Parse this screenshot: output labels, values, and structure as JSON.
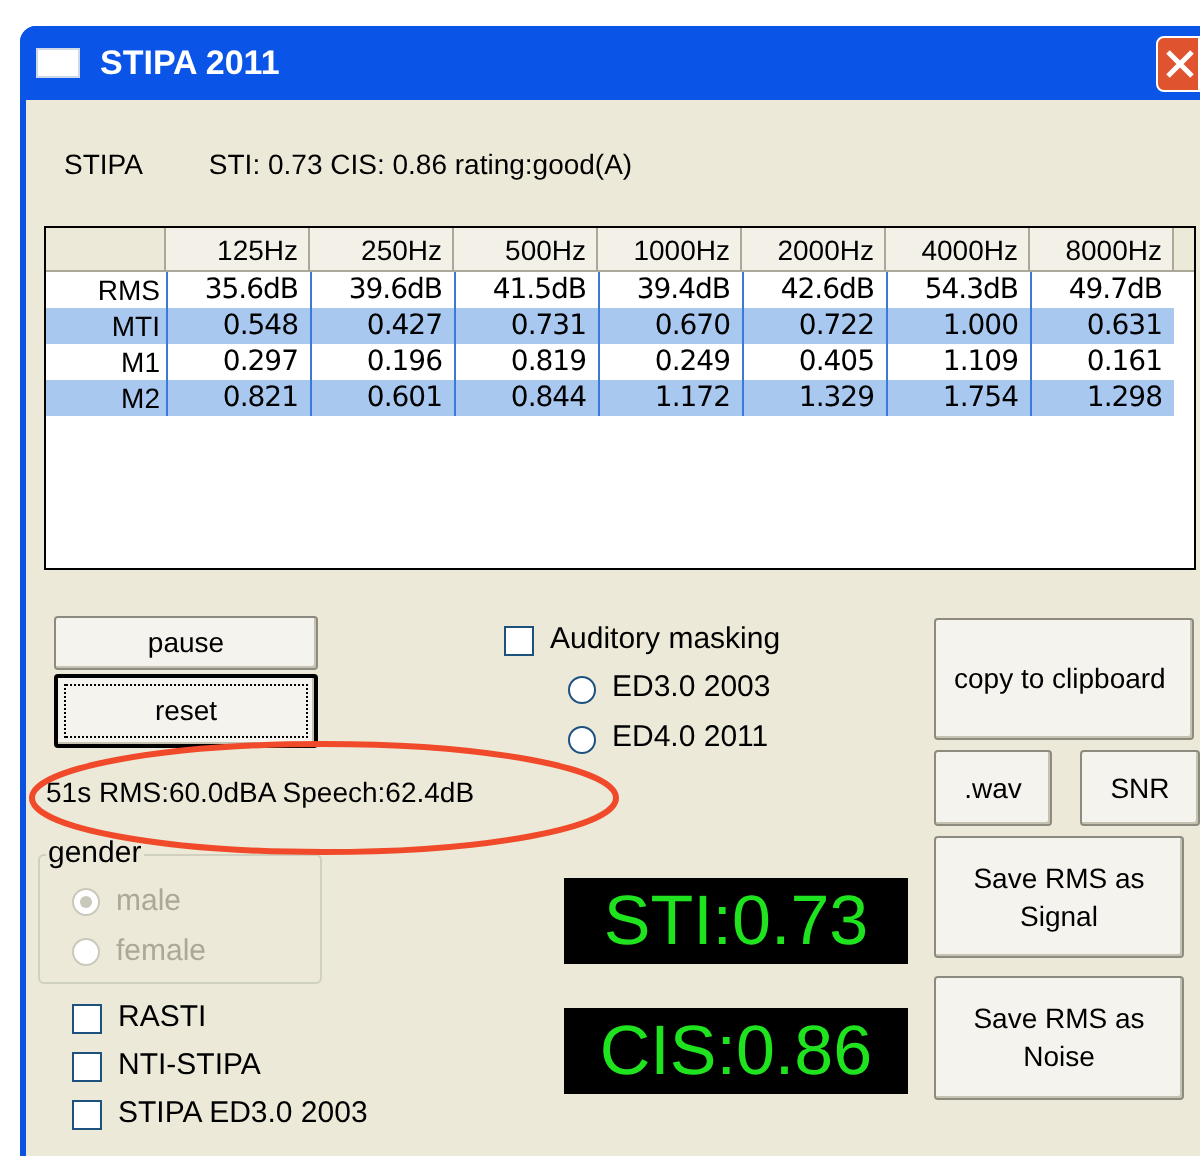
{
  "window": {
    "title": "STIPA 2011"
  },
  "header": {
    "mode": "STIPA",
    "summary": "STI: 0.73 CIS: 0.86 rating:good(A)"
  },
  "table": {
    "columns": [
      "125Hz",
      "250Hz",
      "500Hz",
      "1000Hz",
      "2000Hz",
      "4000Hz",
      "8000Hz"
    ],
    "rows": [
      {
        "label": "RMS",
        "cells": [
          "35.6dB",
          "39.6dB",
          "41.5dB",
          "39.4dB",
          "42.6dB",
          "54.3dB",
          "49.7dB"
        ]
      },
      {
        "label": "MTI",
        "cells": [
          "0.548",
          "0.427",
          "0.731",
          "0.670",
          "0.722",
          "1.000",
          "0.631"
        ]
      },
      {
        "label": "M1",
        "cells": [
          "0.297",
          "0.196",
          "0.819",
          "0.249",
          "0.405",
          "1.109",
          "0.161"
        ]
      },
      {
        "label": "M2",
        "cells": [
          "0.821",
          "0.601",
          "0.844",
          "1.172",
          "1.329",
          "1.754",
          "1.298"
        ]
      }
    ]
  },
  "controls": {
    "pause": "pause",
    "reset": "reset",
    "status": "51s RMS:60.0dBA Speech:62.4dB"
  },
  "gender": {
    "title": "gender",
    "disabled": true,
    "options": [
      {
        "label": "male",
        "selected": true
      },
      {
        "label": "female",
        "selected": false
      }
    ]
  },
  "options": [
    {
      "label": "RASTI",
      "checked": false
    },
    {
      "label": "NTI-STIPA",
      "checked": false
    },
    {
      "label": "STIPA ED3.0 2003",
      "checked": false
    }
  ],
  "masking": {
    "label": "Auditory masking",
    "checked": false,
    "editions": [
      {
        "label": "ED3.0 2003",
        "selected": false
      },
      {
        "label": "ED4.0 2011",
        "selected": false
      }
    ]
  },
  "displays": [
    "STI:0.73",
    "CIS:0.86"
  ],
  "buttons": {
    "copy": "copy to clipboard",
    "wav": ".wav",
    "snr": "SNR",
    "save_signal": "Save RMS as Signal",
    "save_noise": "Save RMS as Noise"
  }
}
